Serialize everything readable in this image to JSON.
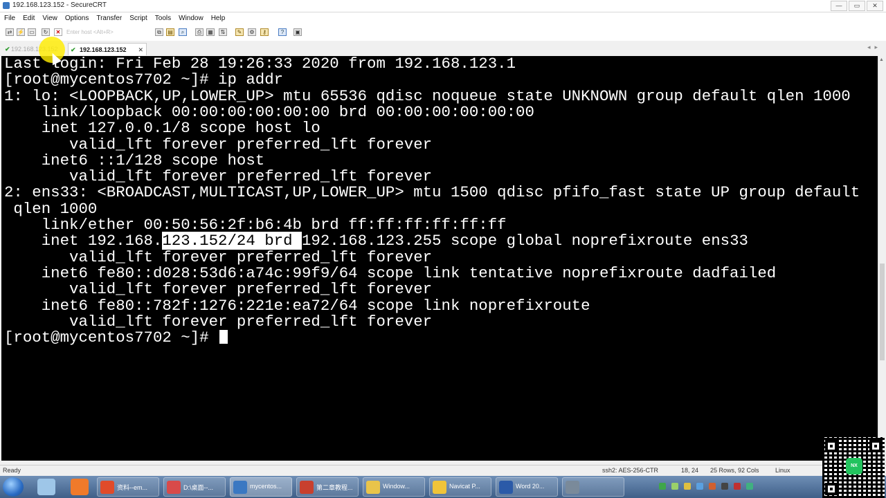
{
  "window": {
    "title": "192.168.123.152 - SecureCRT"
  },
  "menu": [
    "File",
    "Edit",
    "View",
    "Options",
    "Transfer",
    "Script",
    "Tools",
    "Window",
    "Help"
  ],
  "toolbar": {
    "quick_connect_placeholder": "Enter host <Alt+R>"
  },
  "tabs": [
    {
      "label": "192.168.123.152",
      "active": false
    },
    {
      "label": "192.168.123.152",
      "active": true
    }
  ],
  "terminal": {
    "lines": [
      "Last login: Fri Feb 28 19:26:33 2020 from 192.168.123.1",
      "[root@mycentos7702 ~]# ip addr",
      "1: lo: <LOOPBACK,UP,LOWER_UP> mtu 65536 qdisc noqueue state UNKNOWN group default qlen 1000",
      "    link/loopback 00:00:00:00:00:00 brd 00:00:00:00:00:00",
      "    inet 127.0.0.1/8 scope host lo",
      "       valid_lft forever preferred_lft forever",
      "    inet6 ::1/128 scope host",
      "       valid_lft forever preferred_lft forever",
      "2: ens33: <BROADCAST,MULTICAST,UP,LOWER_UP> mtu 1500 qdisc pfifo_fast state UP group default",
      " qlen 1000",
      "    link/ether 00:50:56:2f:b6:4b brd ff:ff:ff:ff:ff:ff",
      "",
      "       valid_lft forever preferred_lft forever",
      "    inet6 fe80::d028:53d6:a74c:99f9/64 scope link tentative noprefixroute dadfailed",
      "       valid_lft forever preferred_lft forever",
      "    inet6 fe80::782f:1276:221e:ea72/64 scope link noprefixroute",
      "       valid_lft forever preferred_lft forever"
    ],
    "inet_line": {
      "before": "    inet 192.168.",
      "selected": "123.152/24 brd ",
      "after": "192.168.123.255 scope global noprefixroute ens33"
    },
    "prompt": "[root@mycentos7702 ~]# "
  },
  "statusbar": {
    "ready": "Ready",
    "cipher": "ssh2: AES-256-CTR",
    "cursor_pos": "18,  24",
    "size": "25 Rows, 92 Cols",
    "os": "Linux"
  },
  "taskbar": {
    "buttons": [
      {
        "label": "资料--em...",
        "color": "#e04b2a"
      },
      {
        "label": "D:\\桌面--...",
        "color": "#d84a4a"
      },
      {
        "label": "mycentos...",
        "color": "#3a78c2"
      },
      {
        "label": "第二章教程...",
        "color": "#c8402e"
      },
      {
        "label": "Window...",
        "color": "#e9c44a"
      },
      {
        "label": "Navicat P...",
        "color": "#f0c43a"
      },
      {
        "label": "Word 20...",
        "color": "#2b5aa8"
      },
      {
        "label": "",
        "color": "#7a8a9a"
      }
    ]
  },
  "qr_logo": "NX",
  "colors": {
    "terminal_bg": "#000000",
    "terminal_fg": "#ffffff",
    "cursor_highlight": "#ffeb00"
  }
}
